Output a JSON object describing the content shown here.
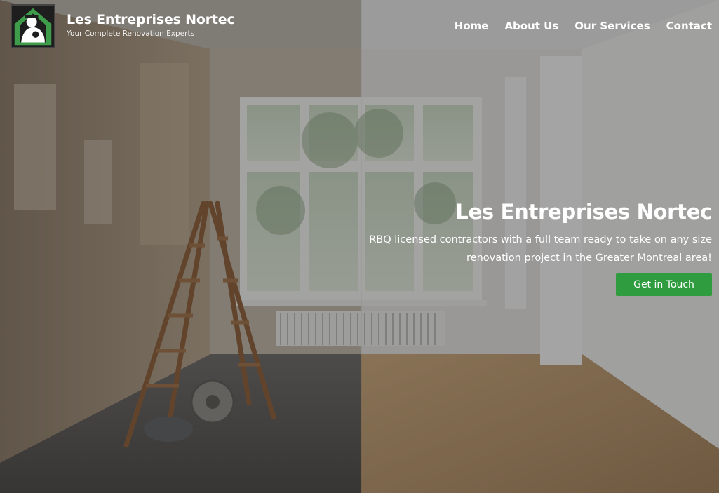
{
  "brand": {
    "name": "Les Entreprises Nortec",
    "tagline": "Your Complete Renovation Experts",
    "logo_icon": "worker-house-logo-icon"
  },
  "nav": {
    "items": [
      {
        "label": "Home"
      },
      {
        "label": "About Us"
      },
      {
        "label": "Our Services"
      },
      {
        "label": "Contact"
      }
    ]
  },
  "hero": {
    "title": "Les Entreprises Nortec",
    "subtitle_line1": "RBQ licensed contractors with a full team ready to take on any size",
    "subtitle_line2": "renovation project in the Greater Montreal area!",
    "cta_label": "Get in Touch",
    "background": "before-after-renovation-room-photo"
  },
  "colors": {
    "accent": "#2f9d3f",
    "text": "#ffffff"
  }
}
